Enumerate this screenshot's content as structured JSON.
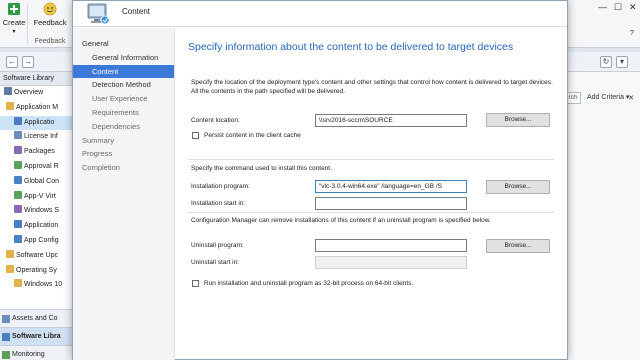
{
  "console": {
    "ribbon": {
      "create_label": "Create",
      "feedback_label": "Feedback",
      "group_label": "Feedback"
    },
    "left_pane": {
      "header": "Software Library",
      "tree": [
        {
          "label": "Overview",
          "color": "#5c7aa8"
        },
        {
          "label": "Application M",
          "color": "#e2b34a"
        },
        {
          "label": "Applicatio",
          "color": "#4a7fc4"
        },
        {
          "label": "License Inf",
          "color": "#6b8fb8"
        },
        {
          "label": "Packages",
          "color": "#8a6ab3"
        },
        {
          "label": "Approval R",
          "color": "#5aa05a"
        },
        {
          "label": "Global Con",
          "color": "#4a7fc4"
        },
        {
          "label": "App-V Virt",
          "color": "#5aa05a"
        },
        {
          "label": "Windows S",
          "color": "#8a6ab3"
        },
        {
          "label": "Application",
          "color": "#4a7fc4"
        },
        {
          "label": "App Config",
          "color": "#4a7fc4"
        },
        {
          "label": "Software Upc",
          "color": "#e2b34a"
        },
        {
          "label": "Operating Sy",
          "color": "#e2b34a"
        },
        {
          "label": "Windows 10",
          "color": "#e2b34a"
        }
      ],
      "workspaces": [
        {
          "label": "Assets and Co"
        },
        {
          "label": "Software Libra"
        },
        {
          "label": "Monitoring"
        }
      ]
    },
    "right_pane": {
      "search_label": "rch",
      "add_criteria": "Add Criteria",
      "add_criteria_arrow": "▾"
    }
  },
  "wizard": {
    "header_title": "Content",
    "steps": [
      {
        "label": "General",
        "level": 1,
        "state": "normal"
      },
      {
        "label": "General Information",
        "level": 2,
        "state": "normal"
      },
      {
        "label": "Content",
        "level": 2,
        "state": "active"
      },
      {
        "label": "Detection Method",
        "level": 2,
        "state": "normal"
      },
      {
        "label": "User Experience",
        "level": 2,
        "state": "dim"
      },
      {
        "label": "Requirements",
        "level": 2,
        "state": "dim"
      },
      {
        "label": "Dependencies",
        "level": 2,
        "state": "dim"
      },
      {
        "label": "Summary",
        "level": 1,
        "state": "dim"
      },
      {
        "label": "Progress",
        "level": 1,
        "state": "dim"
      },
      {
        "label": "Completion",
        "level": 1,
        "state": "dim"
      }
    ],
    "page_title": "Specify information about the content to be delivered to target devices",
    "description": "Specify the location of the deployment type's content and other settings that control how content is delivered to target devices. All the contents in the path specified will be delivered.",
    "content_location_label": "Content location:",
    "content_location_value": "\\\\srv2016-sccm\\SOURCE",
    "browse_label": "Browse...",
    "persist_label": "Persist content in the client cache",
    "command_section_label": "Specify the command used to install this content.",
    "install_program_label": "Installation program:",
    "install_program_value": "\"vlc-3.0.4-win64.exe\" /language=en_GB /S",
    "install_start_label": "Installation start in:",
    "install_start_value": "",
    "uninstall_note": "Configuration Manager can remove installations of this content if an uninstall program is specified below.",
    "uninstall_program_label": "Uninstall program:",
    "uninstall_program_value": "",
    "uninstall_start_label": "Uninstall start in:",
    "uninstall_start_value": "",
    "run_32bit_label": "Run installation and uninstall program as 32-bit process on 64-bit clients."
  }
}
